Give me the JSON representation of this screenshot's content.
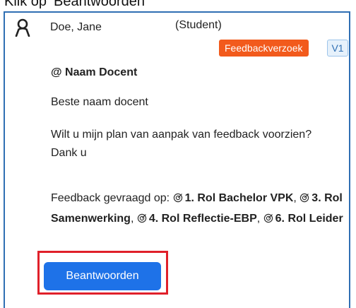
{
  "caption": "Klik op ‘Beantwoorden’",
  "comment": {
    "author": "Doe, Jane",
    "role": "(Student)",
    "badge_type": "Feedbackverzoek",
    "badge_version": "V1",
    "mention": "@ Naam Docent",
    "greeting": "Beste  naam docent",
    "body": "Wilt u mijn plan van aanpak van feedback voorzien? Dank u",
    "requested_label": "Feedback gevraagd op:",
    "competencies": [
      "1. Rol Bachelor VPK",
      "3. Rol Samenwerking",
      "4. Rol Reflectie-EBP",
      "6. Rol Leider"
    ]
  },
  "reply_button": {
    "label": "Beantwoorden"
  },
  "colors": {
    "badge": "#f25a1c",
    "version_badge_bg": "#e6f1fb",
    "button": "#1e72e8",
    "highlight": "#e0202a",
    "card_border": "#2f6fb3"
  },
  "icons": {
    "avatar": "user-icon",
    "competency": "target-check-icon"
  }
}
